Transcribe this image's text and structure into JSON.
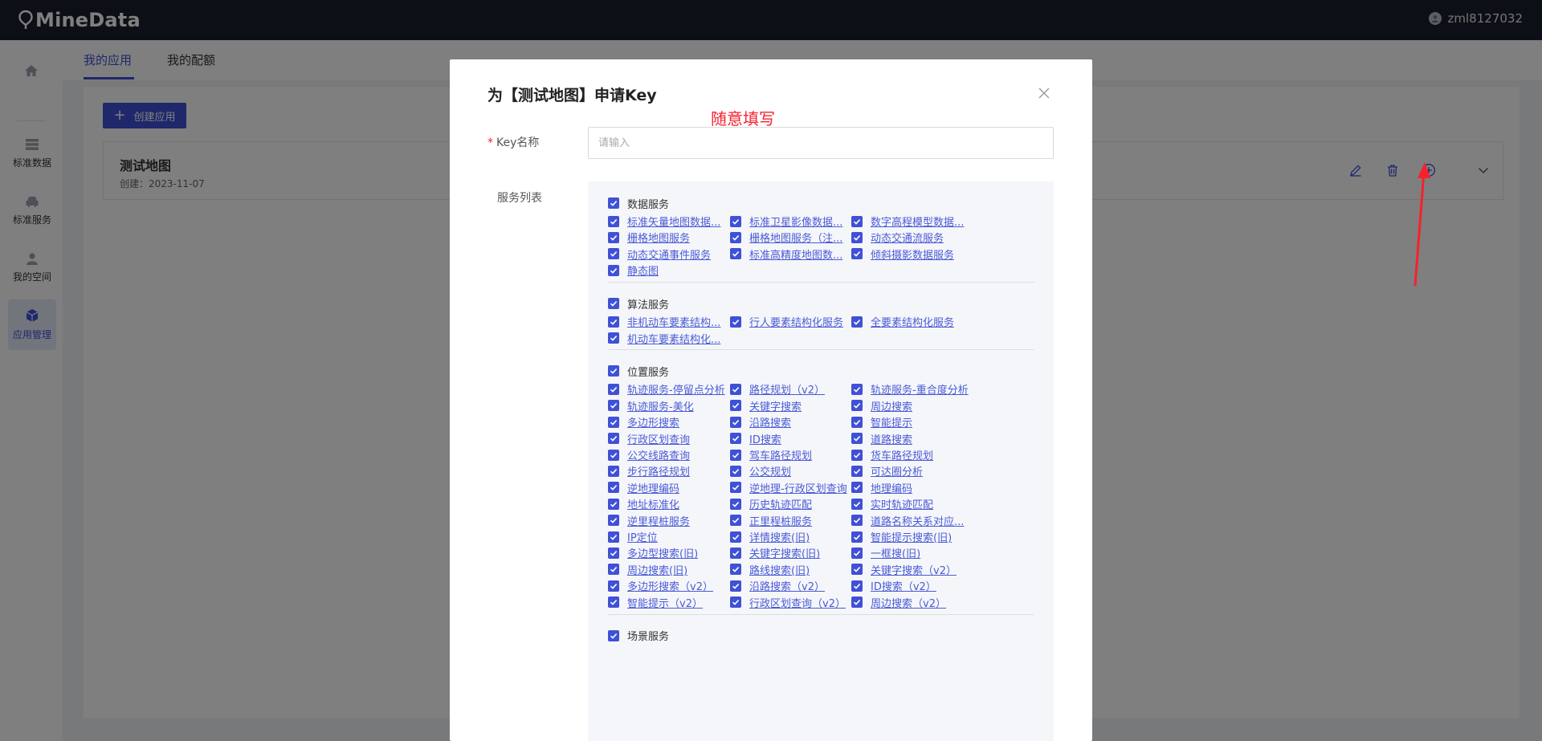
{
  "app": {
    "logo_text": "MineData",
    "username": "zml8127032"
  },
  "sidebar": {
    "items": [
      {
        "label": "标准数据",
        "icon": "database-icon"
      },
      {
        "label": "标准服务",
        "icon": "car-icon"
      },
      {
        "label": "我的空间",
        "icon": "user-icon"
      },
      {
        "label": "应用管理",
        "icon": "cube-icon"
      }
    ],
    "active": "应用管理"
  },
  "tabs": [
    {
      "label": "我的应用"
    },
    {
      "label": "我的配额"
    }
  ],
  "toolbar": {
    "create_label": "创建应用"
  },
  "app_card": {
    "name": "测试地图",
    "created": "创建：2023-11-07"
  },
  "modal": {
    "title": "为【测试地图】申请Key",
    "hint": "随意填写",
    "key_label": "Key名称",
    "key_placeholder": "请输入",
    "key_value": "",
    "services_label": "服务列表",
    "groups": [
      {
        "name": "数据服务",
        "checked": true,
        "items": [
          "标准矢量地图数据...",
          "标准卫星影像数据...",
          "数字高程模型数据...",
          "栅格地图服务",
          "栅格地图服务（注...",
          "动态交通流服务",
          "动态交通事件服务",
          "标准高精度地图数...",
          "倾斜摄影数据服务",
          "静态图"
        ]
      },
      {
        "name": "算法服务",
        "checked": true,
        "items": [
          "非机动车要素结构...",
          "行人要素结构化服务",
          "全要素结构化服务",
          "机动车要素结构化..."
        ]
      },
      {
        "name": "位置服务",
        "checked": true,
        "items": [
          "轨迹服务-停留点分析",
          "路径规划（v2）",
          "轨迹服务-重合度分析",
          "轨迹服务-美化",
          "关键字搜索",
          "周边搜索",
          "多边形搜索",
          "沿路搜索",
          "智能提示",
          "行政区划查询",
          "ID搜索",
          "道路搜索",
          "公交线路查询",
          "驾车路径规划",
          "货车路径规划",
          "步行路径规划",
          "公交规划",
          "可达圈分析",
          "逆地理编码",
          "逆地理-行政区划查询",
          "地理编码",
          "地址标准化",
          "历史轨迹匹配",
          "实时轨迹匹配",
          "逆里程桩服务",
          "正里程桩服务",
          "道路名称关系对应...",
          "IP定位",
          "详情搜索(旧)",
          "智能提示搜索(旧)",
          "多边型搜索(旧)",
          "关键字搜索(旧)",
          "一框搜(旧)",
          "周边搜索(旧)",
          "路线搜索(旧)",
          "关键字搜索（v2）",
          "多边形搜索（v2）",
          "沿路搜索（v2）",
          "ID搜索（v2）",
          "智能提示（v2）",
          "行政区划查询（v2）",
          "周边搜索（v2）"
        ]
      },
      {
        "name": "场景服务",
        "checked": true,
        "items": []
      }
    ]
  },
  "colors": {
    "accent": "#3f51d6",
    "annotation": "#f5222d",
    "topbar": "#1b1f2c"
  }
}
